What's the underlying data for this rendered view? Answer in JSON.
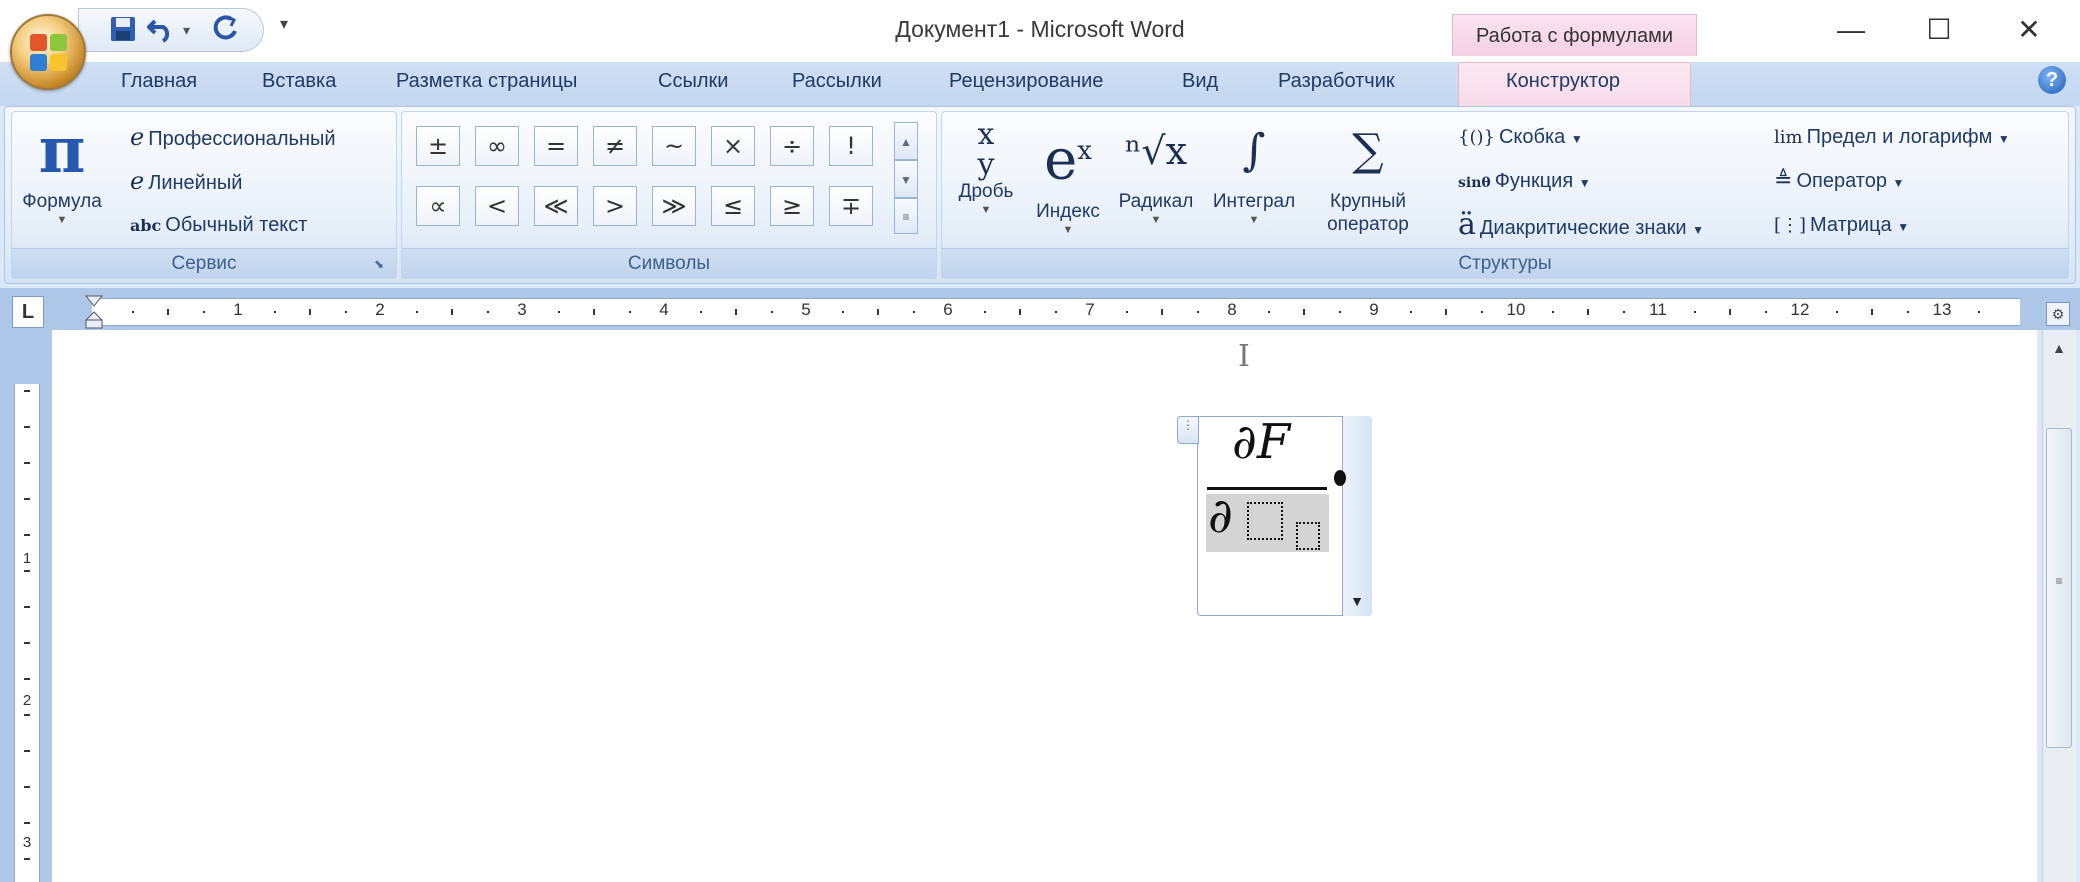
{
  "window": {
    "title": "Документ1 - Microsoft Word",
    "context_tab": "Работа с формулами",
    "controls": {
      "minimize": "—",
      "maximize": "☐",
      "close": "✕"
    }
  },
  "qat": {
    "save_icon": "save-icon",
    "undo_icon": "undo-icon",
    "redo_icon": "redo-icon",
    "customize": "▾"
  },
  "tabs": [
    "Главная",
    "Вставка",
    "Разметка страницы",
    "Ссылки",
    "Рассылки",
    "Рецензирование",
    "Вид",
    "Разработчик",
    "Конструктор"
  ],
  "active_tab": "Конструктор",
  "help": "?",
  "groups": {
    "service": {
      "label": "Сервис",
      "formula": {
        "glyph": "π",
        "label": "Формула"
      },
      "professional": "Профессиональный",
      "linear": "Линейный",
      "plain_text": "Обычный текст",
      "abc": "abc"
    },
    "symbols": {
      "label": "Символы",
      "row1": [
        "±",
        "∞",
        "=",
        "≠",
        "~",
        "×",
        "÷",
        "!"
      ],
      "row2": [
        "∝",
        "<",
        "≪",
        ">",
        "≫",
        "≤",
        "≥",
        "∓"
      ]
    },
    "structures": {
      "label": "Структуры",
      "fraction": "Дробь",
      "index": "Индекс",
      "radical": "Радикал",
      "integral": "Интеграл",
      "large_operator": "Крупный оператор",
      "bracket": "Скобка",
      "function": "Функция",
      "accent": "Диакритические знаки",
      "limit_log": "Предел и логарифм",
      "operator": "Оператор",
      "matrix": "Матрица"
    }
  },
  "ruler": {
    "numbers": [
      "1",
      "2",
      "3",
      "4",
      "5",
      "6",
      "7",
      "8",
      "9",
      "10",
      "11",
      "12",
      "13"
    ],
    "vertical": [
      "1",
      "2",
      "3"
    ]
  },
  "equation": {
    "numerator": "∂F",
    "denominator": "∂"
  }
}
